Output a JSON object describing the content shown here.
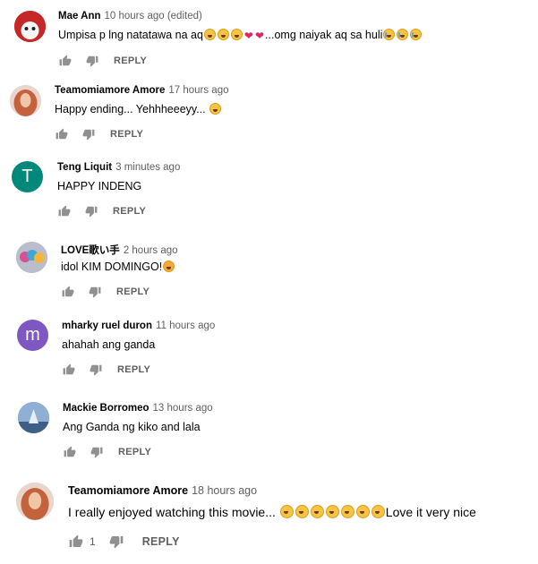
{
  "comments": [
    {
      "author": "Mae Ann",
      "time": "10 hours ago (edited)",
      "text_before": "Umpisa p lng natatawa na aq",
      "text_after": "...omg naiyak aq sa huli",
      "reply": "REPLY",
      "avatar_color": "#c62828"
    },
    {
      "author": "Teamomiamore Amore",
      "time": "17 hours ago",
      "text": "Happy ending... Yehhheeeyy...",
      "reply": "REPLY",
      "avatar_color": "#d98a6a"
    },
    {
      "author": "Teng Liquit",
      "time": "3 minutes ago",
      "text": "HAPPY INDENG",
      "reply": "REPLY",
      "avatar_letter": "T",
      "avatar_color": "#00897b"
    },
    {
      "author": "LOVE歌い手",
      "time": "2 hours ago",
      "text": "idol KIM DOMINGO!",
      "reply": "REPLY",
      "avatar_color": "#a0a6b8"
    },
    {
      "author": "mharky ruel duron",
      "time": "11 hours ago",
      "text": "ahahah ang ganda",
      "reply": "REPLY",
      "avatar_letter": "m",
      "avatar_color": "#7e57c2"
    },
    {
      "author": "Mackie Borromeo",
      "time": "13 hours ago",
      "text": "Ang Ganda ng kiko and lala",
      "reply": "REPLY",
      "avatar_color": "#6f8fb5"
    },
    {
      "author": "Teamomiamore Amore",
      "time": "18 hours ago",
      "text_before": "I really enjoyed watching this movie...",
      "text_after": "Love it very nice",
      "likes": "1",
      "reply": "REPLY",
      "avatar_color": "#d98a6a"
    }
  ],
  "icons": {
    "like": "thumb-up-icon",
    "dislike": "thumb-down-icon"
  }
}
